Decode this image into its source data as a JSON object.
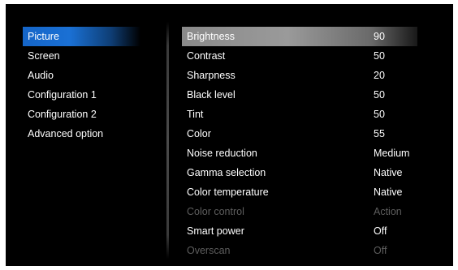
{
  "left_menu": {
    "items": [
      {
        "label": "Picture",
        "active": true
      },
      {
        "label": "Screen",
        "active": false
      },
      {
        "label": "Audio",
        "active": false
      },
      {
        "label": "Configuration 1",
        "active": false
      },
      {
        "label": "Configuration 2",
        "active": false
      },
      {
        "label": "Advanced option",
        "active": false
      }
    ]
  },
  "settings": {
    "rows": [
      {
        "name": "Brightness",
        "value": "90",
        "selected": true,
        "enabled": true
      },
      {
        "name": "Contrast",
        "value": "50",
        "selected": false,
        "enabled": true
      },
      {
        "name": "Sharpness",
        "value": "20",
        "selected": false,
        "enabled": true
      },
      {
        "name": "Black level",
        "value": "50",
        "selected": false,
        "enabled": true
      },
      {
        "name": "Tint",
        "value": "50",
        "selected": false,
        "enabled": true
      },
      {
        "name": "Color",
        "value": "55",
        "selected": false,
        "enabled": true
      },
      {
        "name": "Noise reduction",
        "value": "Medium",
        "selected": false,
        "enabled": true
      },
      {
        "name": "Gamma selection",
        "value": "Native",
        "selected": false,
        "enabled": true
      },
      {
        "name": "Color temperature",
        "value": "Native",
        "selected": false,
        "enabled": true
      },
      {
        "name": "Color control",
        "value": "Action",
        "selected": false,
        "enabled": false
      },
      {
        "name": "Smart power",
        "value": "Off",
        "selected": false,
        "enabled": true
      },
      {
        "name": "Overscan",
        "value": "Off",
        "selected": false,
        "enabled": false
      }
    ]
  },
  "colors": {
    "background": "#000000",
    "active_tab": "#1a70d4",
    "selected_row": "#9a9a9a",
    "text": "#ffffff",
    "disabled_text": "#5e5e5e"
  }
}
